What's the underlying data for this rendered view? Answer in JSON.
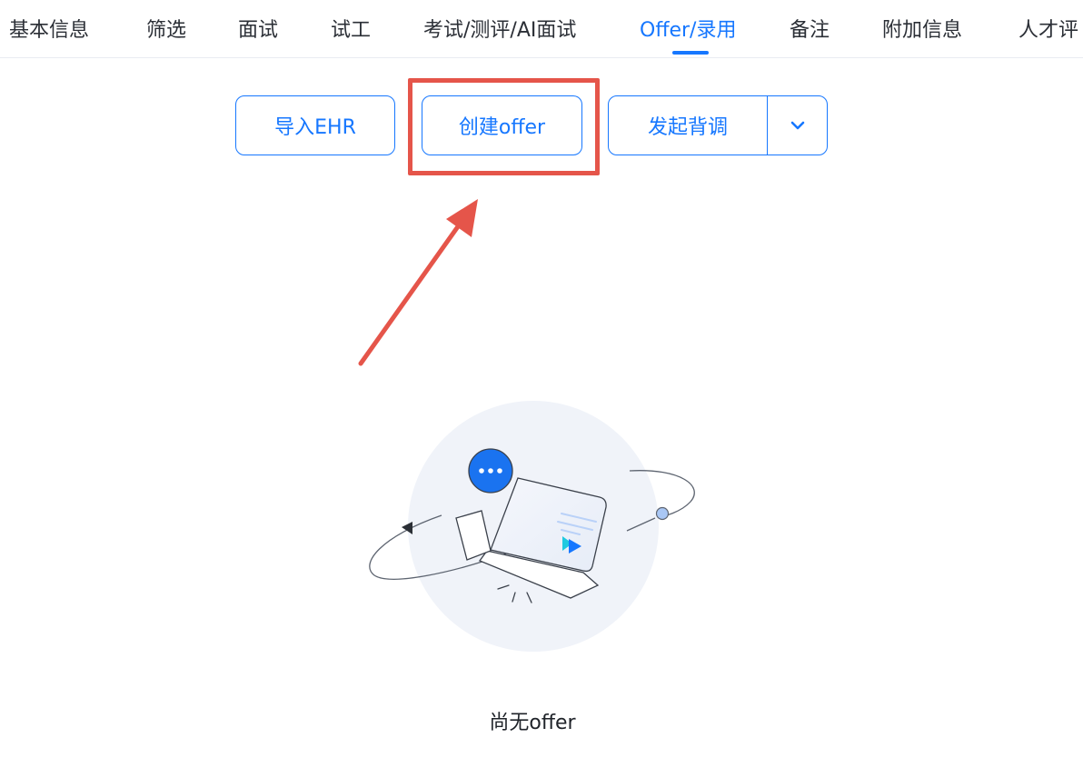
{
  "tabs": [
    {
      "label": "基本信息",
      "active": false
    },
    {
      "label": "筛选",
      "active": false
    },
    {
      "label": "面试",
      "active": false
    },
    {
      "label": "试工",
      "active": false
    },
    {
      "label": "考试/测评/AI面试",
      "active": false
    },
    {
      "label": "Offer/录用",
      "active": true
    },
    {
      "label": "备注",
      "active": false
    },
    {
      "label": "附加信息",
      "active": false
    },
    {
      "label": "人才评",
      "active": false
    }
  ],
  "actions": {
    "import_label": "导入EHR",
    "create_label": "创建offer",
    "background_check_label": "发起背调",
    "dropdown_icon": "chevron-down-icon"
  },
  "empty_state": {
    "message": "尚无offer",
    "illustration": "laptop-chat-illustration"
  },
  "annotation": {
    "highlight_color": "#e5554a",
    "arrow_color": "#e5554a"
  },
  "colors": {
    "accent": "#1677ff",
    "text": "#2b2f36"
  }
}
